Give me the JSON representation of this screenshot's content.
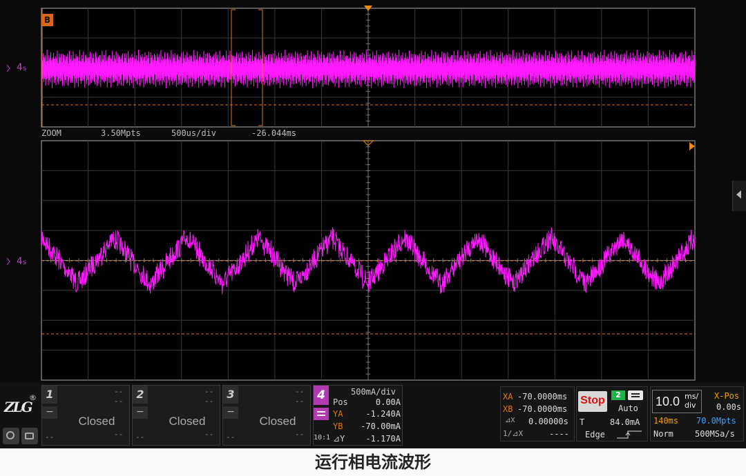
{
  "upper_view": {
    "badge": "B",
    "ch_marker": "4",
    "zoom_label": "ZOOM",
    "points": "3.50Mpts",
    "timebase": "500us/div",
    "offset": "-26.044ms"
  },
  "lower_view": {
    "ch_marker": "4"
  },
  "channels": [
    {
      "num": "1",
      "state": "Closed",
      "dash": "--"
    },
    {
      "num": "2",
      "state": "Closed",
      "dash": "--"
    },
    {
      "num": "3",
      "state": "Closed",
      "dash": "--"
    }
  ],
  "ch4": {
    "num": "4",
    "scale": "500mA/div",
    "pos_label": "Pos",
    "pos_value": "0.00A",
    "ya_label": "YA",
    "ya_value": "-1.240A",
    "yb_label": "YB",
    "yb_value": "-70.00mA",
    "dy_label": "⊿Y",
    "dy_value": "-1.170A",
    "ratio": "10:1"
  },
  "cursors": {
    "xa_label": "XA",
    "xa_value": "-70.0000ms",
    "xb_label": "XB",
    "xb_value": "-70.0000ms",
    "dx_label": "⊿X",
    "dx_value": "0.00000s",
    "inv_label": "1/⊿X",
    "inv_value": "----"
  },
  "trigger": {
    "run_state": "Stop",
    "channel": "2",
    "mode": "Auto",
    "t_label": "T",
    "level": "84.0mA",
    "type": "Edge"
  },
  "horizontal": {
    "scale_value": "10.0",
    "scale_unit_top": "ms/",
    "scale_unit_bottom": "div",
    "xpos_label": "X-Pos",
    "xpos_value": "0.00s",
    "memory_time": "140ms",
    "memory_points": "70.0Mpts",
    "acq_mode": "Norm",
    "sample_rate": "500MSa/s"
  },
  "logo": {
    "text": "ZLG",
    "reg": "®"
  },
  "caption": "运行相电流波形",
  "colors": {
    "trace": "#ff1aff",
    "cursor": "#e07a10",
    "stop": "#e01010",
    "trigger_ch": "#21b24a",
    "memory_time": "#f0a000",
    "memory_points": "#3aa0ff"
  },
  "chart_data": {
    "type": "line",
    "title": "",
    "xlabel": "",
    "ylabel": "",
    "series": [
      {
        "values": [
          0.7,
          -0.7,
          0.7,
          -0.7,
          0.7,
          -0.7,
          0.7,
          -0.7,
          0.7,
          -0.7,
          0.7,
          -0.7,
          0.7,
          -0.7,
          0.7,
          -0.7,
          0.7,
          -0.7,
          0.7
        ]
      }
    ]
  }
}
